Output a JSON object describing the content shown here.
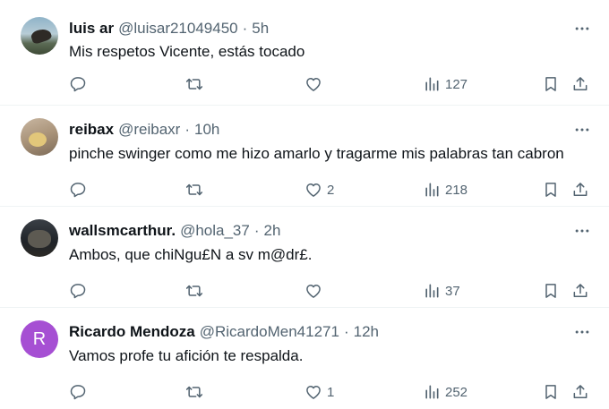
{
  "tweets": [
    {
      "name": "luis ar",
      "handle": "@luisar21049450",
      "time": "5h",
      "text": "Mis respetos Vicente, estás tocado",
      "replies": "",
      "retweets": "",
      "likes": "",
      "views": "127",
      "avatar_icon": "user-photo-avatar"
    },
    {
      "name": "reibax",
      "handle": "@reibaxr",
      "time": "10h",
      "text": "pinche swinger como me hizo amarlo y tragarme mis palabras tan cabron",
      "replies": "",
      "retweets": "",
      "likes": "2",
      "views": "218",
      "avatar_icon": "user-photo-avatar"
    },
    {
      "name": "wallsmcarthur.",
      "handle": "@hola_37",
      "time": "2h",
      "text": "Ambos, que chiNgu£N a sv m@dr£.",
      "replies": "",
      "retweets": "",
      "likes": "",
      "views": "37",
      "avatar_icon": "user-photo-avatar"
    },
    {
      "name": "Ricardo Mendoza",
      "handle": "@RicardoMen41271",
      "time": "12h",
      "text": "Vamos profe tu afición te respalda.",
      "replies": "",
      "retweets": "",
      "likes": "1",
      "views": "252",
      "avatar_letter": "R",
      "avatar_color": "#a64fd3"
    }
  ],
  "separator": "·",
  "colors": {
    "text_primary": "#0f1419",
    "text_secondary": "#536471",
    "divider": "#eff3f4"
  },
  "icons": [
    "more-icon",
    "reply-icon",
    "retweet-icon",
    "like-icon",
    "views-icon",
    "bookmark-icon",
    "share-icon"
  ]
}
